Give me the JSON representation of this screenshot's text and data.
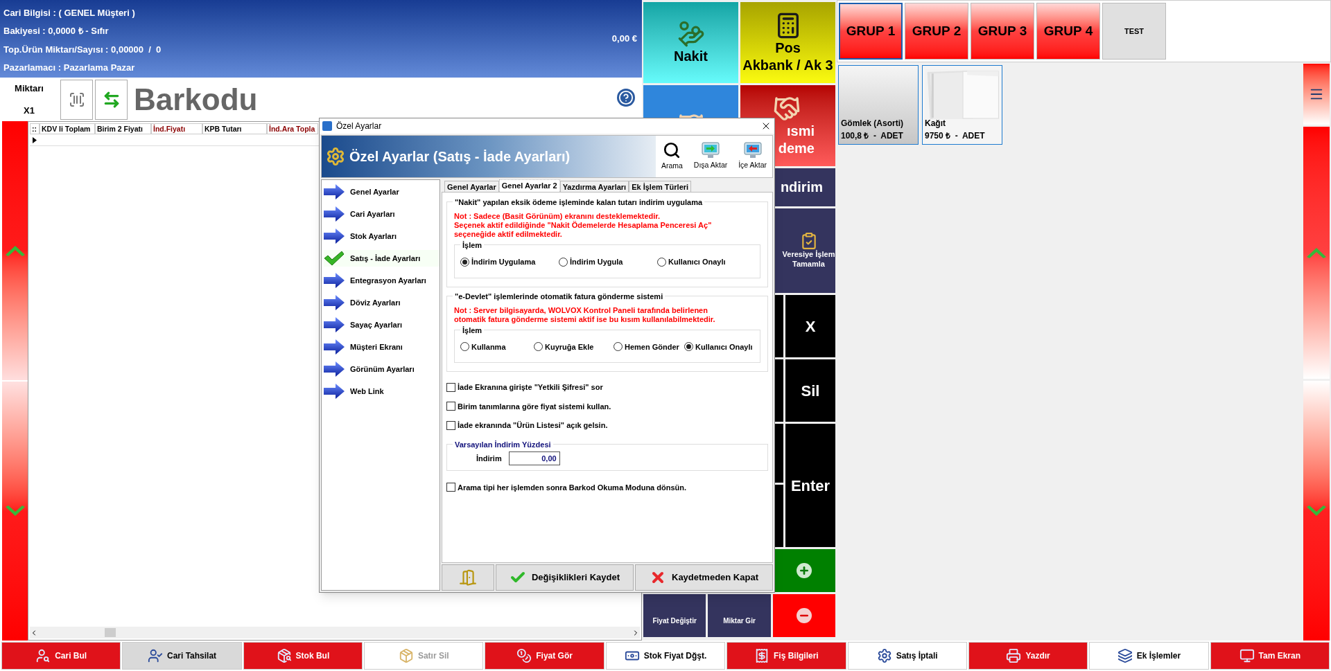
{
  "customer_panel": {
    "lines": [
      "Cari Bilgisi : ( GENEL Müşteri )",
      "Bakiyesi : 0,0000 ₺ - Sıfır",
      "Top.Ürün Miktarı/Sayısı : 0,00000  /  0",
      "Pazarlamacı : Pazarlama Pazar"
    ],
    "total": "0,00 €"
  },
  "barcode_bar": {
    "quantity_label": "Miktarı",
    "quantity": "X1",
    "input_label": "Barkodu"
  },
  "sales_grid": {
    "columns": [
      {
        "label": "::",
        "highlight": false
      },
      {
        "label": "KDV li Toplam",
        "highlight": false
      },
      {
        "label": "Birim 2 Fiyatı",
        "highlight": false
      },
      {
        "label": "İnd.Fiyatı",
        "highlight": true
      },
      {
        "label": "KPB Tutarı",
        "highlight": false
      },
      {
        "label": "İnd.Ara Topla",
        "highlight": true
      }
    ]
  },
  "payment_buttons": [
    {
      "kind": "cash",
      "lines": [
        "Nakit"
      ]
    },
    {
      "kind": "pos",
      "lines": [
        "Pos",
        "Akbank / Ak 3"
      ]
    },
    {
      "kind": "card"
    },
    {
      "kind": "partial",
      "lines": [
        "ısmi",
        "deme"
      ]
    },
    {
      "kind": "discount",
      "lines": [
        "ndirim"
      ]
    },
    {
      "kind": "credit",
      "lines": [
        "Veresiye İşlem",
        "Tamamla"
      ]
    }
  ],
  "keypad": {
    "keys": [
      "X",
      "Sil",
      "Enter"
    ],
    "actions": [
      "Fiyat Değiştir",
      "Miktar Gir"
    ]
  },
  "groups": [
    {
      "label": "GRUP 1",
      "kind": "group",
      "selected": true
    },
    {
      "label": "GRUP 2",
      "kind": "group",
      "selected": false
    },
    {
      "label": "GRUP 3",
      "kind": "group",
      "selected": false
    },
    {
      "label": "GRUP 4",
      "kind": "group",
      "selected": false
    },
    {
      "label": "TEST",
      "kind": "plain",
      "selected": false
    }
  ],
  "products": [
    {
      "name": "Gömlek (Asorti)",
      "price": "100,8 ₺  -  ADET",
      "kind": "plain"
    },
    {
      "name": "Kağıt",
      "price": "9750 ₺  -  ADET",
      "kind": "picture"
    }
  ],
  "bottom_bar": [
    {
      "label": "Cari Bul",
      "color": "#e0121a",
      "disabled": false
    },
    {
      "label": "Cari Tahsilat",
      "color": "#d9d9d9",
      "disabled": false
    },
    {
      "label": "Stok Bul",
      "color": "#e0121a",
      "disabled": false
    },
    {
      "label": "Satır Sil",
      "color": "#ffffff",
      "disabled": true
    },
    {
      "label": "Fiyat Gör",
      "color": "#e0121a",
      "disabled": false
    },
    {
      "label": "Stok Fiyat Dğşt.",
      "color": "#ffffff",
      "disabled": false
    },
    {
      "label": "Fiş Bilgileri",
      "color": "#e0121a",
      "disabled": false
    },
    {
      "label": "Satış İptali",
      "color": "#ffffff",
      "disabled": false
    },
    {
      "label": "Yazdır",
      "color": "#e0121a",
      "disabled": false
    },
    {
      "label": "Ek İşlemler",
      "color": "#ffffff",
      "disabled": false
    },
    {
      "label": "Tam Ekran",
      "color": "#e0121a",
      "disabled": false
    }
  ],
  "dialog": {
    "title": "Özel Ayarlar",
    "header": "Özel Ayarlar (Satış - İade Ayarları)",
    "toolbar": [
      "Arama",
      "Dışa Aktar",
      "İçe Aktar"
    ],
    "nav": [
      {
        "label": "Genel Ayarlar",
        "selected": false
      },
      {
        "label": "Cari Ayarları",
        "selected": false
      },
      {
        "label": "Stok Ayarları",
        "selected": false
      },
      {
        "label": "Satış - İade Ayarları",
        "selected": true
      },
      {
        "label": "Entegrasyon Ayarları",
        "selected": false
      },
      {
        "label": "Döviz Ayarları",
        "selected": false
      },
      {
        "label": "Sayaç Ayarları",
        "selected": false
      },
      {
        "label": "Müşteri Ekranı",
        "selected": false
      },
      {
        "label": "Görünüm Ayarları",
        "selected": false
      },
      {
        "label": "Web Link",
        "selected": false
      }
    ],
    "tabs": [
      {
        "label": "Genel Ayarlar",
        "selected": false
      },
      {
        "label": "Genel Ayarlar 2",
        "selected": true
      },
      {
        "label": "Yazdırma Ayarları",
        "selected": false
      },
      {
        "label": "Ek İşlem Türleri",
        "selected": false
      }
    ],
    "groups": [
      {
        "legend": "\"Nakit\" yapılan eksik ödeme işleminde kalan tutarı indirim uygulama",
        "note": [
          "Not : Sadece (Basit Görünüm) ekranını desteklemektedir.",
          "Seçenek aktif edildiğinde \"Nakit Ödemelerde Hesaplama Penceresi Aç\"",
          "seçeneğide aktif edilmektedir."
        ],
        "options_legend": "İşlem",
        "options": [
          {
            "label": "İndirim Uygulama",
            "selected": true
          },
          {
            "label": "İndirim Uygula",
            "selected": false
          },
          {
            "label": "Kullanıcı Onaylı",
            "selected": false
          }
        ]
      },
      {
        "legend": "\"e-Devlet\" işlemlerinde otomatik fatura gönderme sistemi",
        "note": [
          "Not : Server bilgisayarda, WOLVOX Kontrol Paneli tarafında belirlenen",
          "otomatik fatura gönderme sistemi aktif ise bu kısım kullanılabilmektedir."
        ],
        "options_legend": "İşlem",
        "options": [
          {
            "label": "Kullanma",
            "selected": false
          },
          {
            "label": "Kuyruğa Ekle",
            "selected": false
          },
          {
            "label": "Hemen Gönder",
            "selected": false
          },
          {
            "label": "Kullanıcı Onaylı",
            "selected": true
          }
        ]
      }
    ],
    "checkboxes": [
      {
        "label": "İade Ekranına girişte \"Yetkili Şifresi\" sor",
        "checked": false
      },
      {
        "label": "Birim tanımlarına göre fiyat sistemi kullan.",
        "checked": false
      },
      {
        "label": "İade ekranında \"Ürün Listesi\" açık gelsin.",
        "checked": false
      }
    ],
    "discount": {
      "legend": "Varsayılan İndirim Yüzdesi",
      "label": "İndirim",
      "value": "0,00"
    },
    "last_checkbox": {
      "label": "Arama tipi her işlemden sonra Barkod Okuma Moduna dönsün.",
      "checked": false
    },
    "footer_buttons": [
      "Değişiklikleri Kaydet",
      "Kaydetmeden Kapat"
    ]
  }
}
